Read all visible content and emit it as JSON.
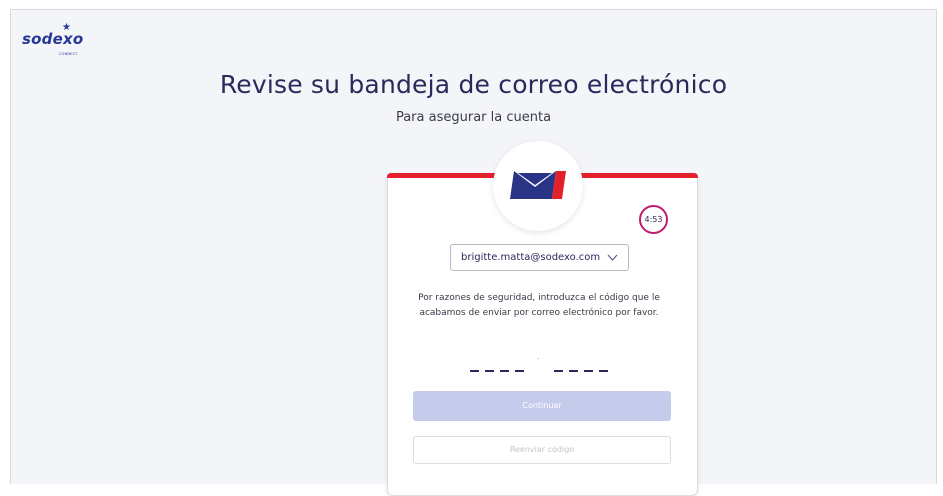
{
  "brand": {
    "logo_text": "sodexo",
    "logo_tagline": "CONNECT",
    "colors": {
      "brand_blue": "#283897",
      "accent_red": "#e4202c",
      "timer_ring": "#c01a6e",
      "button_disabled": "#c5cbea"
    }
  },
  "header": {
    "title": "Revise su bandeja de correo electrónico",
    "subtitle": "Para asegurar la cuenta"
  },
  "card": {
    "icon": "envelope-icon",
    "timer": "4:53",
    "email_select": {
      "value": "brigitte.matta@sodexo.com",
      "icon": "chevron-down-icon"
    },
    "instructions": "Por razones de seguridad, introduzca el código que le acabamos de enviar por correo electrónico por favor.",
    "code": {
      "left_slots": 4,
      "right_slots": 4,
      "separator": "-"
    },
    "continue_label": "Continuar",
    "resend_label": "Reenviar código"
  }
}
